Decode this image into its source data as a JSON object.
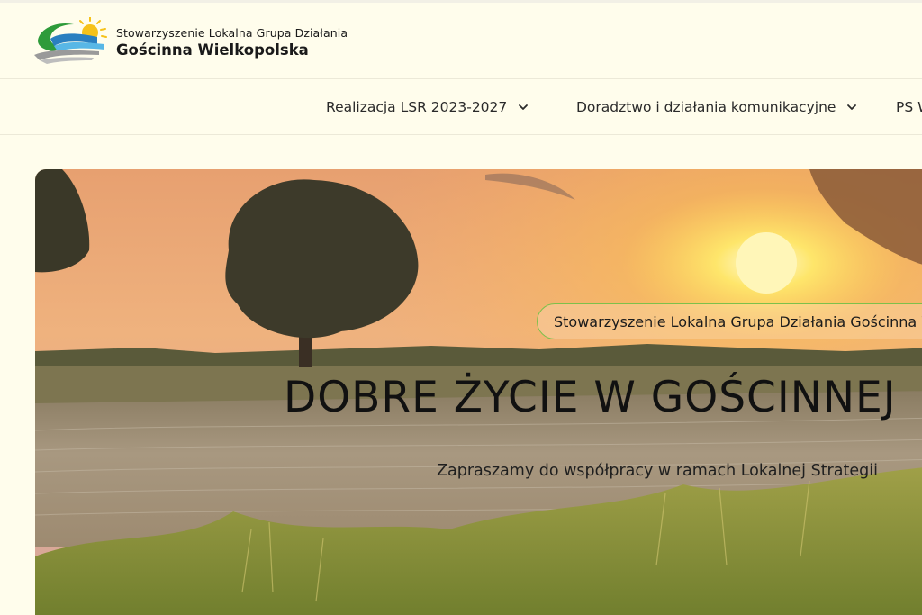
{
  "header": {
    "org_subtitle": "Stowarzyszenie Lokalna Grupa Działania",
    "org_name": "Gościnna Wielkopolska"
  },
  "nav": {
    "items": [
      {
        "label": "Realizacja LSR 2023-2027"
      },
      {
        "label": "Doradztwo i działania komunikacyjne"
      },
      {
        "label": "PS W"
      }
    ]
  },
  "hero": {
    "badge": "Stowarzyszenie Lokalna Grupa Działania Gościnna Wielkopolska",
    "title": "DOBRE ŻYCIE W GOŚCINNEJ",
    "description": "Zapraszamy do współpracy w ramach Lokalnej Strategii"
  },
  "colors": {
    "page_background": "#fffdec",
    "badge_border": "#7cc04b",
    "text": "#111111"
  },
  "icons": {
    "logo": "sun-wave-logo",
    "nav_chevron": "chevron-down-icon"
  }
}
